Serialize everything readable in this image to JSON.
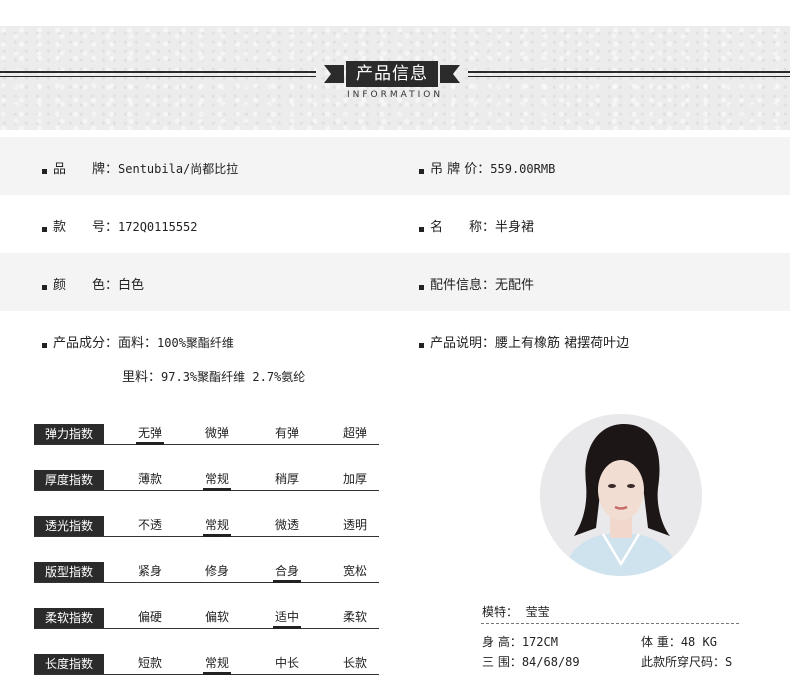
{
  "header": {
    "title": "产品信息",
    "subtitle": "INFORMATION"
  },
  "info": {
    "brand_label": "品　　牌：",
    "brand_value": "Sentubila/尚都比拉",
    "tag_price_label": "吊 牌 价：",
    "tag_price_value": "559.00RMB",
    "style_no_label": "款　　号：",
    "style_no_value": "172Q0115552",
    "name_label": "名　　称：",
    "name_value": "半身裙",
    "color_label": "颜　　色：",
    "color_value": "白色",
    "accessory_label": "配件信息：",
    "accessory_value": "无配件",
    "composition_label": "产品成分：",
    "fabric_label": "面料：",
    "fabric_value": "100%聚酯纤维",
    "lining_label": "里料：",
    "lining_value": "97.3%聚酯纤维 2.7%氨纶",
    "description_label": "产品说明：",
    "description_value": "腰上有橡筋 裙摆荷叶边"
  },
  "indices": [
    {
      "label": "弹力指数",
      "options": [
        "无弹",
        "微弹",
        "有弹",
        "超弹"
      ],
      "selected": 0
    },
    {
      "label": "厚度指数",
      "options": [
        "薄款",
        "常规",
        "稍厚",
        "加厚"
      ],
      "selected": 1
    },
    {
      "label": "透光指数",
      "options": [
        "不透",
        "常规",
        "微透",
        "透明"
      ],
      "selected": 1
    },
    {
      "label": "版型指数",
      "options": [
        "紧身",
        "修身",
        "合身",
        "宽松"
      ],
      "selected": 2
    },
    {
      "label": "柔软指数",
      "options": [
        "偏硬",
        "偏软",
        "适中",
        "柔软"
      ],
      "selected": 2
    },
    {
      "label": "长度指数",
      "options": [
        "短款",
        "常规",
        "中长",
        "长款"
      ],
      "selected": 1
    }
  ],
  "model": {
    "label": "模特：",
    "name": "莹莹",
    "height_label": "身 高：",
    "height_value": "172CM",
    "weight_label": "体 重：",
    "weight_value": "48 KG",
    "measurements_label": "三 围：",
    "measurements_value": "84/68/89",
    "size_label": "此款所穿尺码：",
    "size_value": "S"
  },
  "colors": {
    "dark": "#2b2b2b",
    "header_bg": "#ececec",
    "row_shade": "#f4f4f4"
  }
}
